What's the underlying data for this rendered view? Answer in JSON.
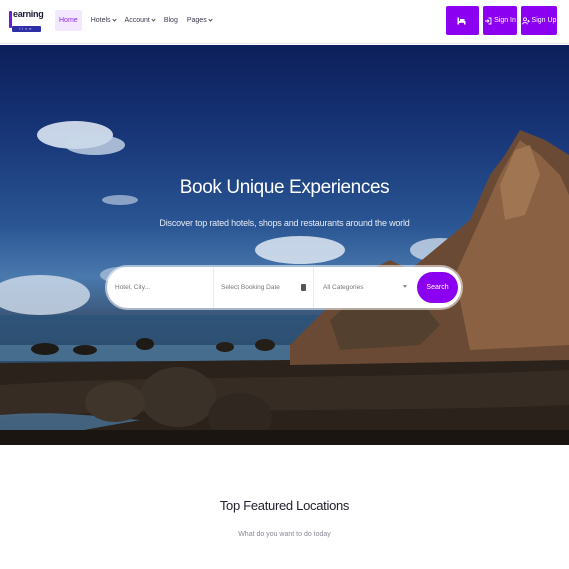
{
  "brand": {
    "logo_text": "earning",
    "logo_tagline": "live"
  },
  "nav": {
    "items": [
      {
        "label": "Home",
        "active": true,
        "has_dropdown": false
      },
      {
        "label": "Hotels",
        "active": false,
        "has_dropdown": true
      },
      {
        "label": "Account",
        "active": false,
        "has_dropdown": true
      },
      {
        "label": "Blog",
        "active": false,
        "has_dropdown": false
      },
      {
        "label": "Pages",
        "active": false,
        "has_dropdown": true
      }
    ],
    "actions": {
      "cart_icon": "bed-icon",
      "signin_label": "Sign In",
      "signup_label": "Sign Up"
    }
  },
  "hero": {
    "title": "Book Unique Experiences",
    "subtitle": "Discover top rated hotels, shops and restaurants around the world"
  },
  "search": {
    "hotel_placeholder": "Hotel, City...",
    "date_placeholder": "Select Booking Date",
    "category_value": "All Categories",
    "button_label": "Search"
  },
  "featured": {
    "title": "Top Featured Locations",
    "subtitle": "What do you want to do today"
  },
  "colors": {
    "accent": "#8b00f0",
    "active_nav_bg": "#f3e8ff"
  }
}
